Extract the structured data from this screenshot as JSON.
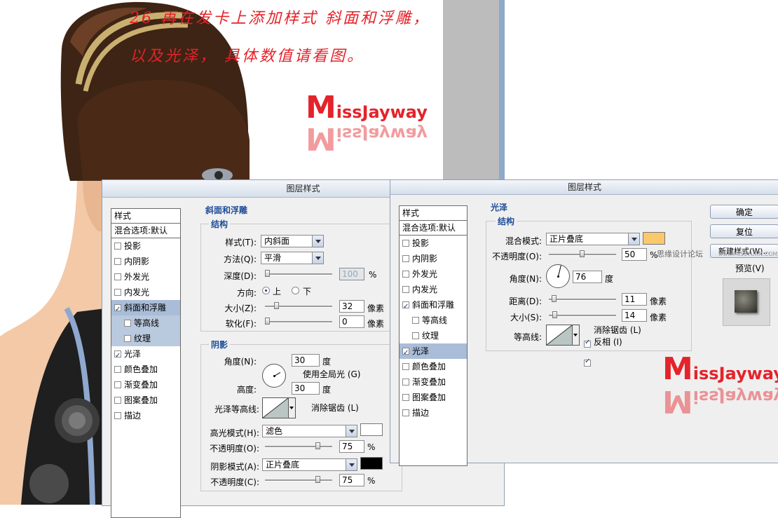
{
  "caption": {
    "line1": "26 再在发卡上添加样式 斜面和浮雕，",
    "line2": "以及光泽， 具体数值请看图。"
  },
  "watermark": {
    "text_big": "M",
    "text_rest": "issJayway",
    "site_text": "思缘设计论坛",
    "site_url": "www.MISSYUAN.COM"
  },
  "dialog_left": {
    "title": "图层样式",
    "list_header": "样式",
    "blend_item": "混合选项:默认",
    "items": [
      {
        "label": "投影",
        "checked": false
      },
      {
        "label": "内阴影",
        "checked": false
      },
      {
        "label": "外发光",
        "checked": false
      },
      {
        "label": "内发光",
        "checked": false
      },
      {
        "label": "斜面和浮雕",
        "checked": true,
        "selected": true
      },
      {
        "label": "等高线",
        "checked": false,
        "sub": true
      },
      {
        "label": "纹理",
        "checked": false,
        "sub": true
      },
      {
        "label": "光泽",
        "checked": true
      },
      {
        "label": "颜色叠加",
        "checked": false
      },
      {
        "label": "渐变叠加",
        "checked": false
      },
      {
        "label": "图案叠加",
        "checked": false
      },
      {
        "label": "描边",
        "checked": false
      }
    ],
    "section_title": "斜面和浮雕",
    "structure": {
      "title": "结构",
      "style_label": "样式(T):",
      "style_value": "内斜面",
      "technique_label": "方法(Q):",
      "technique_value": "平滑",
      "depth_label": "深度(D):",
      "depth_value": "100",
      "depth_unit": "%",
      "depth_fraction": 0.0,
      "direction_label": "方向:",
      "dir_up": "上",
      "dir_down": "下",
      "size_label": "大小(Z):",
      "size_value": "32",
      "size_unit": "像素",
      "size_fraction": 0.13,
      "soften_label": "软化(F):",
      "soften_value": "0",
      "soften_unit": "像素",
      "soften_fraction": 0.0
    },
    "shading": {
      "title": "阴影",
      "angle_label": "角度(N):",
      "angle_value": "30",
      "angle_unit": "度",
      "global_light_label": "使用全局光 (G)",
      "global_light_checked": true,
      "altitude_label": "高度:",
      "altitude_value": "30",
      "altitude_unit": "度",
      "gloss_contour_label": "光泽等高线:",
      "anti_alias_label": "消除锯齿 (L)",
      "anti_alias_checked": true,
      "highlight_mode_label": "高光模式(H):",
      "highlight_mode_value": "滤色",
      "highlight_color": "#ffffff",
      "highlight_opacity_label": "不透明度(O):",
      "highlight_opacity_value": "75",
      "highlight_opacity_unit": "%",
      "highlight_opacity_fraction": 0.75,
      "shadow_mode_label": "阴影模式(A):",
      "shadow_mode_value": "正片叠底",
      "shadow_color": "#000000",
      "shadow_opacity_label": "不透明度(C):",
      "shadow_opacity_value": "75",
      "shadow_opacity_unit": "%",
      "shadow_opacity_fraction": 0.75
    }
  },
  "dialog_right": {
    "title": "图层样式",
    "list_header": "样式",
    "blend_item": "混合选项:默认",
    "items": [
      {
        "label": "投影",
        "checked": false
      },
      {
        "label": "内阴影",
        "checked": false
      },
      {
        "label": "外发光",
        "checked": false
      },
      {
        "label": "内发光",
        "checked": false
      },
      {
        "label": "斜面和浮雕",
        "checked": true
      },
      {
        "label": "等高线",
        "checked": false,
        "sub": true
      },
      {
        "label": "纹理",
        "checked": false,
        "sub": true
      },
      {
        "label": "光泽",
        "checked": true,
        "selected": true
      },
      {
        "label": "颜色叠加",
        "checked": false
      },
      {
        "label": "渐变叠加",
        "checked": false
      },
      {
        "label": "图案叠加",
        "checked": false
      },
      {
        "label": "描边",
        "checked": false
      }
    ],
    "section_title": "光泽",
    "structure": {
      "title": "结构",
      "blend_label": "混合模式:",
      "blend_value": "正片叠底",
      "blend_color": "#f9c96b",
      "opacity_label": "不透明度(O):",
      "opacity_value": "50",
      "opacity_unit": "%",
      "opacity_fraction": 0.5,
      "angle_label": "角度(N):",
      "angle_value": "76",
      "angle_unit": "度",
      "distance_label": "距离(D):",
      "distance_value": "11",
      "distance_unit": "像素",
      "distance_fraction": 0.04,
      "size_label": "大小(S):",
      "size_value": "14",
      "size_unit": "像素",
      "size_fraction": 0.05,
      "contour_label": "等高线:",
      "anti_alias_label": "消除锯齿 (L)",
      "anti_alias_checked": true,
      "invert_label": "反相 (I)",
      "invert_checked": true
    },
    "buttons": {
      "ok": "确定",
      "reset": "复位",
      "new_style": "新建样式(W)..."
    },
    "preview_label": "预览(V)",
    "preview_checked": true
  }
}
